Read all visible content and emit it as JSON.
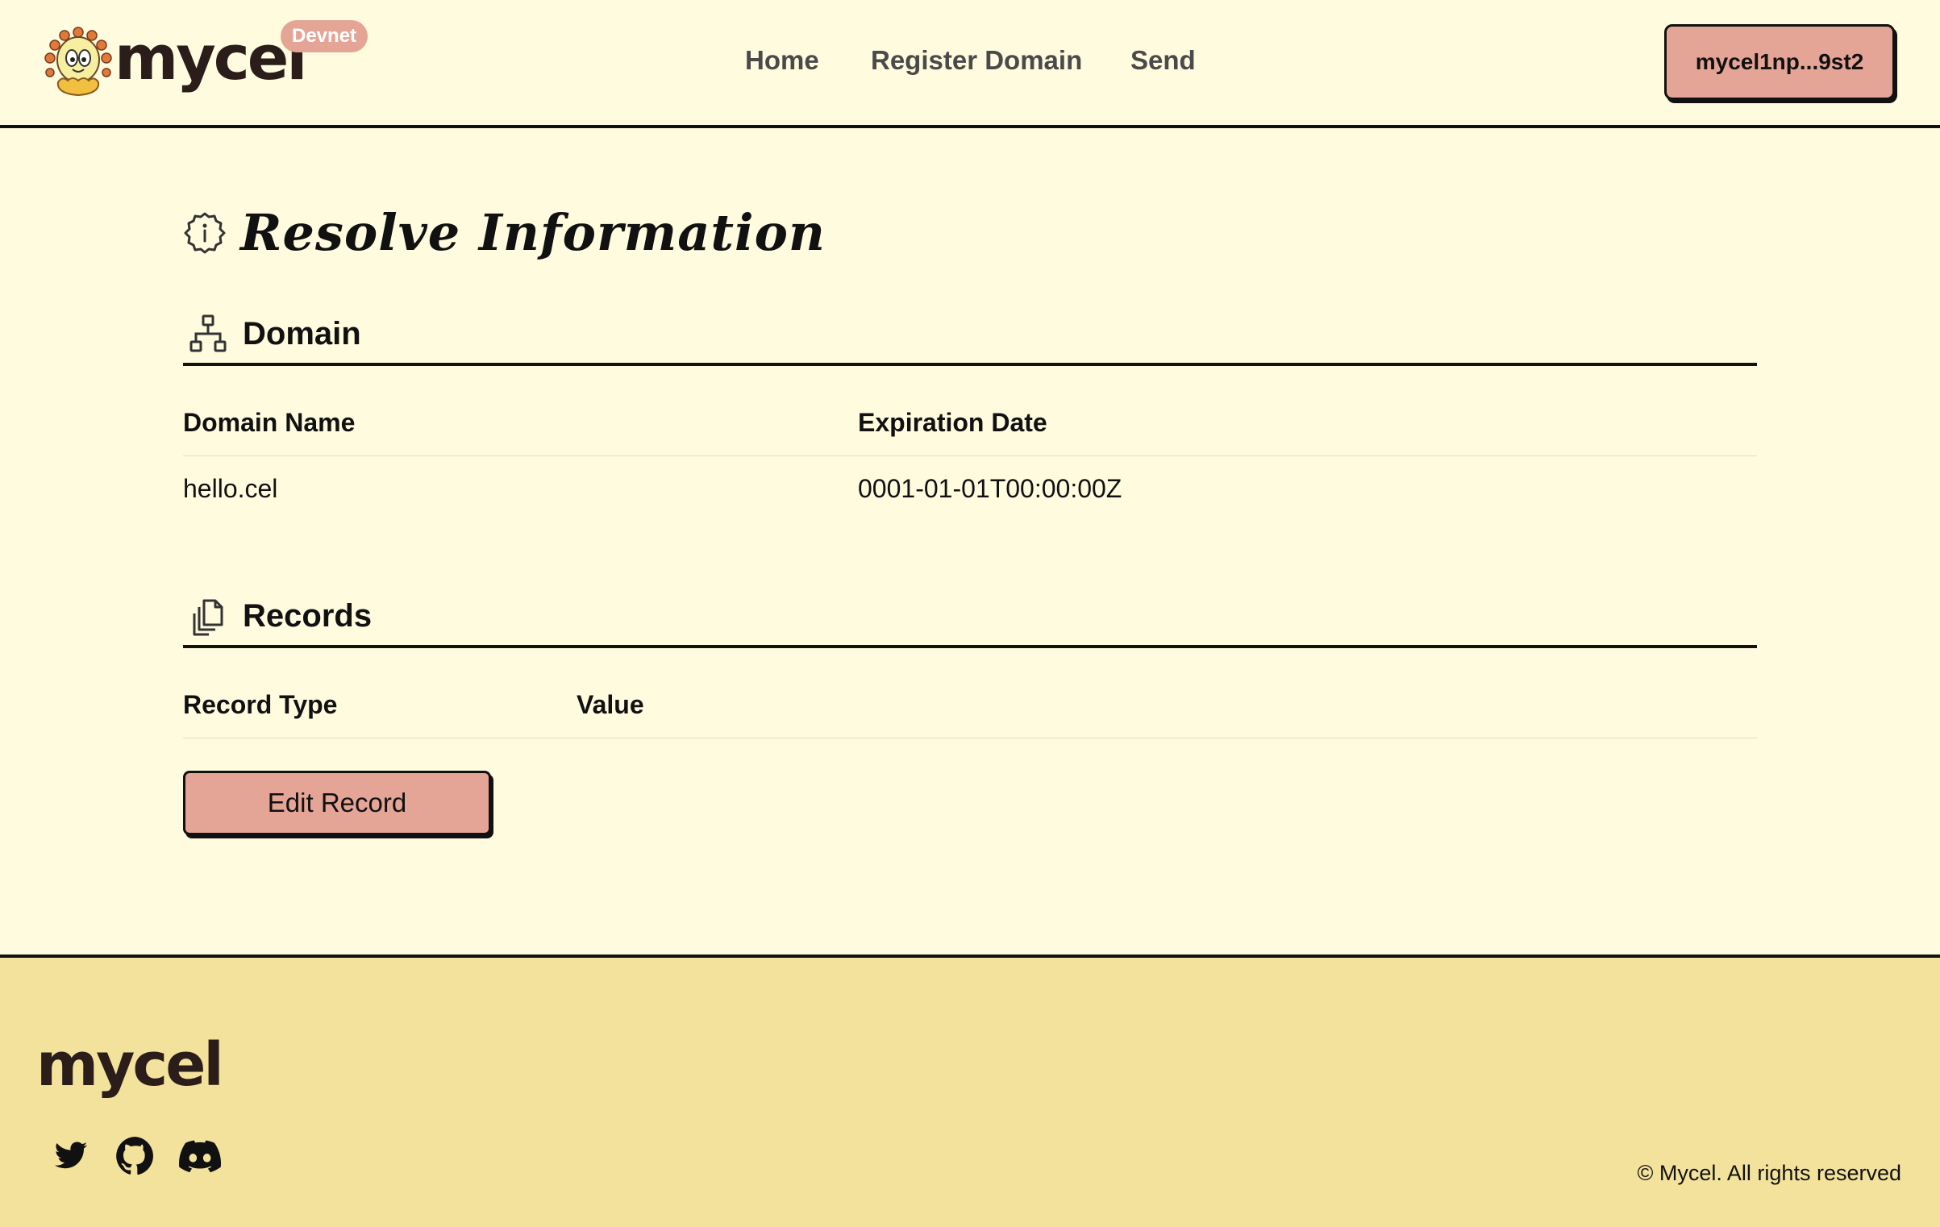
{
  "header": {
    "logo_text": "mycel",
    "network_badge": "Devnet",
    "nav": [
      {
        "label": "Home"
      },
      {
        "label": "Register Domain"
      },
      {
        "label": "Send"
      }
    ],
    "wallet_address": "mycel1np...9st2"
  },
  "main": {
    "page_title": "Resolve Information",
    "title_icon": "info-icon",
    "domain_section": {
      "title": "Domain",
      "icon": "hierarchy-icon",
      "columns": [
        "Domain Name",
        "Expiration Date"
      ],
      "rows": [
        {
          "domain_name": "hello.cel",
          "expiration_date": "0001-01-01T00:00:00Z"
        }
      ]
    },
    "records_section": {
      "title": "Records",
      "icon": "documents-icon",
      "columns": [
        "Record Type",
        "Value"
      ],
      "rows": [],
      "edit_button": "Edit Record"
    }
  },
  "footer": {
    "logo_text": "mycel",
    "social": [
      {
        "icon": "twitter-icon"
      },
      {
        "icon": "github-icon"
      },
      {
        "icon": "discord-icon"
      }
    ],
    "copyright": "© Mycel. All rights reserved"
  },
  "colors": {
    "background": "#fefbdf",
    "footer_background": "#f3e29c",
    "accent": "#e5a596",
    "border": "#111111",
    "brand_text": "#2b1d1a"
  }
}
